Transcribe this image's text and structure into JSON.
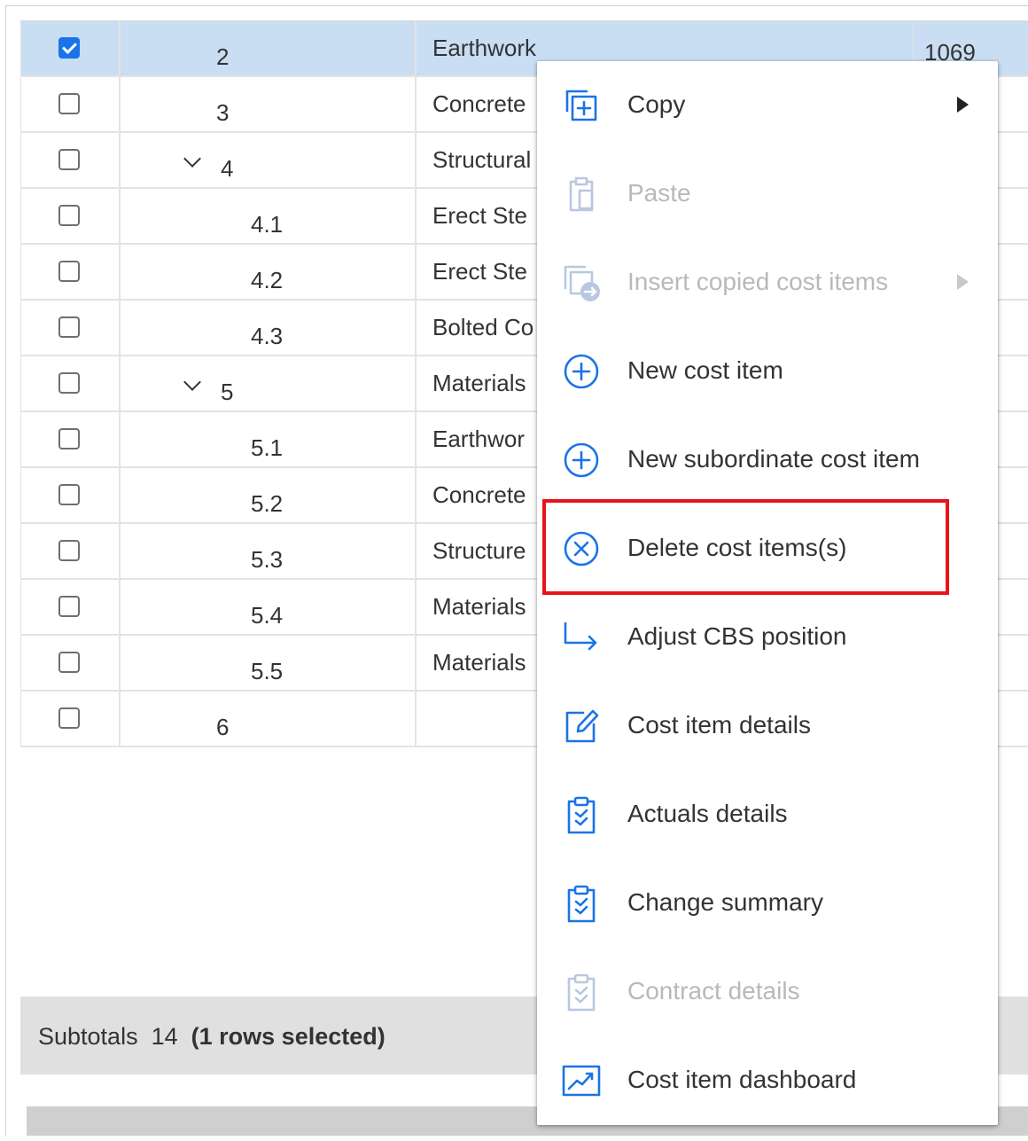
{
  "grid": {
    "rows": [
      {
        "checked": true,
        "code": "2",
        "level": 0,
        "expandable": false,
        "description": "Earthwork",
        "quantity": "1069"
      },
      {
        "checked": false,
        "code": "3",
        "level": 0,
        "expandable": false,
        "description": "Concrete",
        "quantity": ""
      },
      {
        "checked": false,
        "code": "4",
        "level": 0,
        "expandable": true,
        "description": "Structural",
        "quantity": ""
      },
      {
        "checked": false,
        "code": "4.1",
        "level": 1,
        "expandable": false,
        "description": "Erect Ste",
        "quantity": ""
      },
      {
        "checked": false,
        "code": "4.2",
        "level": 1,
        "expandable": false,
        "description": "Erect Ste",
        "quantity": ""
      },
      {
        "checked": false,
        "code": "4.3",
        "level": 1,
        "expandable": false,
        "description": "Bolted Co",
        "quantity": ""
      },
      {
        "checked": false,
        "code": "5",
        "level": 0,
        "expandable": true,
        "description": "Materials",
        "quantity": ""
      },
      {
        "checked": false,
        "code": "5.1",
        "level": 1,
        "expandable": false,
        "description": "Earthwor",
        "quantity": ""
      },
      {
        "checked": false,
        "code": "5.2",
        "level": 1,
        "expandable": false,
        "description": "Concrete",
        "quantity": ""
      },
      {
        "checked": false,
        "code": "5.3",
        "level": 1,
        "expandable": false,
        "description": "Structure",
        "quantity": ""
      },
      {
        "checked": false,
        "code": "5.4",
        "level": 1,
        "expandable": false,
        "description": "Materials",
        "quantity": ""
      },
      {
        "checked": false,
        "code": "5.5",
        "level": 1,
        "expandable": false,
        "description": "Materials",
        "quantity": ""
      },
      {
        "checked": false,
        "code": "6",
        "level": 0,
        "expandable": false,
        "description": "",
        "quantity": ""
      }
    ]
  },
  "subtotals": {
    "label": "Subtotals",
    "count": "14",
    "selection": "(1 rows selected)"
  },
  "context_menu": {
    "items": [
      {
        "label": "Copy",
        "icon": "copy-add-icon",
        "disabled": false,
        "submenu": true
      },
      {
        "label": "Paste",
        "icon": "paste-icon",
        "disabled": true,
        "submenu": false
      },
      {
        "label": "Insert copied cost items",
        "icon": "insert-copied-icon",
        "disabled": true,
        "submenu": true
      },
      {
        "label": "New cost item",
        "icon": "plus-circle-icon",
        "disabled": false,
        "submenu": false
      },
      {
        "label": "New subordinate cost item",
        "icon": "plus-circle-icon",
        "disabled": false,
        "submenu": false
      },
      {
        "label": "Delete cost items(s)",
        "icon": "x-circle-icon",
        "disabled": false,
        "submenu": false,
        "highlighted": true
      },
      {
        "label": "Adjust CBS position",
        "icon": "arrow-down-right-icon",
        "disabled": false,
        "submenu": false
      },
      {
        "label": "Cost item details",
        "icon": "edit-icon",
        "disabled": false,
        "submenu": false
      },
      {
        "label": "Actuals details",
        "icon": "clipboard-check-icon",
        "disabled": false,
        "submenu": false
      },
      {
        "label": "Change summary",
        "icon": "clipboard-check-icon",
        "disabled": false,
        "submenu": false
      },
      {
        "label": "Contract details",
        "icon": "clipboard-check-icon",
        "disabled": true,
        "submenu": false
      },
      {
        "label": "Cost item dashboard",
        "icon": "chart-line-icon",
        "disabled": false,
        "submenu": false
      }
    ]
  },
  "colors": {
    "accent": "#1a73e8",
    "disabled": "#b9b9b9",
    "selected_row": "#c9ddf3",
    "highlight": "#e8141b"
  }
}
